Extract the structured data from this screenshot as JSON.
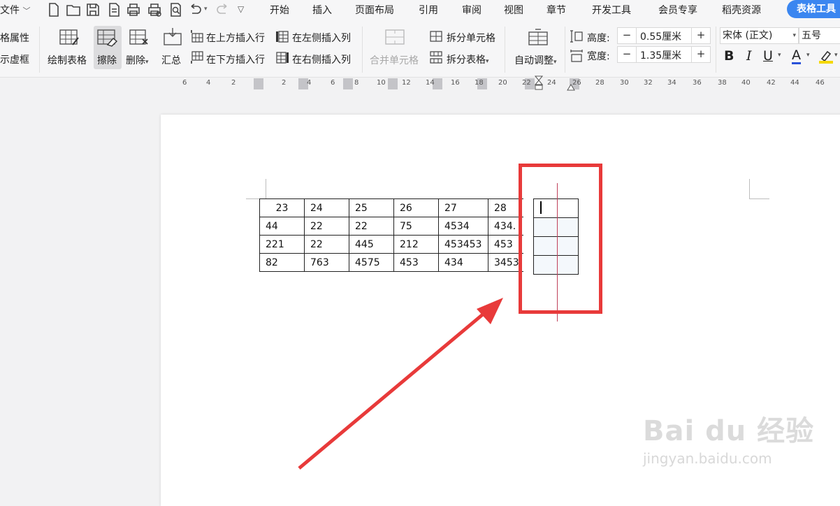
{
  "menubar": {
    "file_label": "文件",
    "tabs": [
      "开始",
      "插入",
      "页面布局",
      "引用",
      "审阅",
      "视图",
      "章节",
      "开发工具",
      "会员专享",
      "稻壳资源"
    ],
    "active_tab": "表格工具"
  },
  "ribbon": {
    "table_props": "格属性",
    "show_virtual": "示虚框",
    "draw_table": "绘制表格",
    "erase": "擦除",
    "delete": "删除",
    "summary": "汇总",
    "insert_above": "在上方插入行",
    "insert_below": "在下方插入行",
    "insert_left": "在左侧插入列",
    "insert_right": "在右侧插入列",
    "merge_cells": "合并单元格",
    "split_cells": "拆分单元格",
    "split_table": "拆分表格",
    "auto_fit": "自动调整",
    "height_label": "高度:",
    "height_value": "0.55厘米",
    "width_label": "宽度:",
    "width_value": "1.35厘米",
    "font_name": "宋体 (正文)",
    "font_size": "五号",
    "bold": "B",
    "italic": "I",
    "underline": "U",
    "font_color": "A"
  },
  "ruler": {
    "labels": [
      "6",
      "4",
      "2",
      "2",
      "4",
      "6",
      "8",
      "10",
      "12",
      "14",
      "16",
      "18",
      "20",
      "22",
      "24",
      "26",
      "28",
      "30",
      "32",
      "34",
      "36",
      "38",
      "40",
      "42",
      "44",
      "46"
    ]
  },
  "document": {
    "table": {
      "rows": [
        [
          "23",
          "24",
          "25",
          "26",
          "27",
          "28"
        ],
        [
          "44",
          "22",
          "22",
          "75",
          "4534",
          "434."
        ],
        [
          "221",
          "22",
          "445",
          "212",
          "453453",
          "453"
        ],
        [
          "82",
          "763",
          "4575",
          "453",
          "434",
          "3453"
        ]
      ]
    }
  },
  "watermark": {
    "brand": "Bai du 经验",
    "url": "jingyan.baidu.com"
  },
  "colors": {
    "accent": "#3b86f0",
    "highlight_box": "#e83a3a",
    "arrow": "#e83a3a"
  }
}
